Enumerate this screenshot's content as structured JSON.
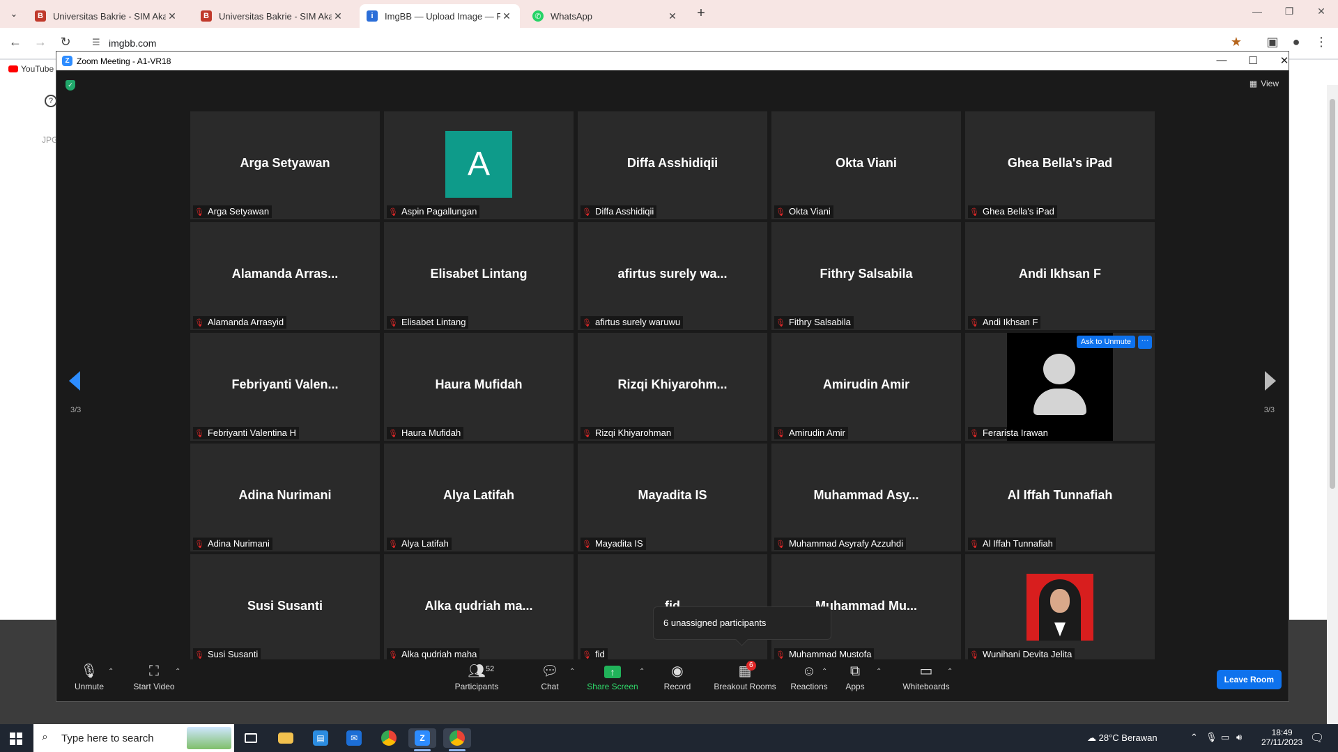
{
  "browser": {
    "tabs": [
      {
        "title": "Universitas Bakrie - SIM Akader",
        "active": false
      },
      {
        "title": "Universitas Bakrie - SIM Akader",
        "active": false
      },
      {
        "title": "ImgBB — Upload Image — Free",
        "active": true
      },
      {
        "title": "WhatsApp",
        "active": false
      }
    ],
    "url": "imgbb.com",
    "bookmark_youtube": "YouTube"
  },
  "page_behind": {
    "help_glyph": "?",
    "jpg_label": "JPG"
  },
  "zoom": {
    "window_title": "Zoom Meeting - A1-VR18",
    "view_label": "View",
    "page_indicator_left": "3/3",
    "page_indicator_right": "3/3",
    "ask_to_unmute": "Ask to Unmute",
    "more_label": "···",
    "avatar_letter": "A",
    "tiles": [
      {
        "big": "Arga Setyawan",
        "label": "Arga Setyawan"
      },
      {
        "big": "",
        "label": "Aspin Pagallungan"
      },
      {
        "big": "Diffa Asshidiqii",
        "label": "Diffa Asshidiqii"
      },
      {
        "big": "Okta Viani",
        "label": "Okta Viani"
      },
      {
        "big": "Ghea Bella's iPad",
        "label": "Ghea Bella's iPad"
      },
      {
        "big": "Alamanda Arras...",
        "label": "Alamanda Arrasyid"
      },
      {
        "big": "Elisabet Lintang",
        "label": "Elisabet Lintang"
      },
      {
        "big": "afirtus surely wa...",
        "label": "afirtus surely waruwu"
      },
      {
        "big": "Fithry Salsabila",
        "label": "Fithry Salsabila"
      },
      {
        "big": "Andi Ikhsan F",
        "label": "Andi Ikhsan F"
      },
      {
        "big": "Febriyanti Valen...",
        "label": "Febriyanti Valentina H"
      },
      {
        "big": "Haura Mufidah",
        "label": "Haura Mufidah"
      },
      {
        "big": "Rizqi Khiyarohm...",
        "label": "Rizqi Khiyarohman"
      },
      {
        "big": "Amirudin Amir",
        "label": "Amirudin Amir"
      },
      {
        "big": "",
        "label": "Ferarista Irawan"
      },
      {
        "big": "Adina Nurimani",
        "label": "Adina Nurimani"
      },
      {
        "big": "Alya Latifah",
        "label": "Alya Latifah"
      },
      {
        "big": "Mayadita IS",
        "label": "Mayadita IS"
      },
      {
        "big": "Muhammad Asy...",
        "label": "Muhammad Asyrafy Azzuhdi"
      },
      {
        "big": "Al Iffah Tunnafiah",
        "label": "Al Iffah Tunnafiah"
      },
      {
        "big": "Susi Susanti",
        "label": "Susi Susanti"
      },
      {
        "big": "Alka qudriah ma...",
        "label": "Alka qudriah maha"
      },
      {
        "big": "fid",
        "label": "fid"
      },
      {
        "big": "Muhammad Mu...",
        "label": "Muhammad Mustofa"
      },
      {
        "big": "",
        "label": "Wunihani Devita Jelita"
      }
    ],
    "tooltip": "6 unassigned participants",
    "controls": {
      "unmute": "Unmute",
      "start_video": "Start Video",
      "participants": "Participants",
      "participants_count": "52",
      "chat": "Chat",
      "share_screen": "Share Screen",
      "record": "Record",
      "breakout_rooms": "Breakout Rooms",
      "breakout_badge": "6",
      "reactions": "Reactions",
      "apps": "Apps",
      "whiteboards": "Whiteboards",
      "leave_room": "Leave Room"
    }
  },
  "taskbar": {
    "search_placeholder": "Type here to search",
    "weather": "28°C  Berawan",
    "time": "18:49",
    "date": "27/11/2023"
  }
}
